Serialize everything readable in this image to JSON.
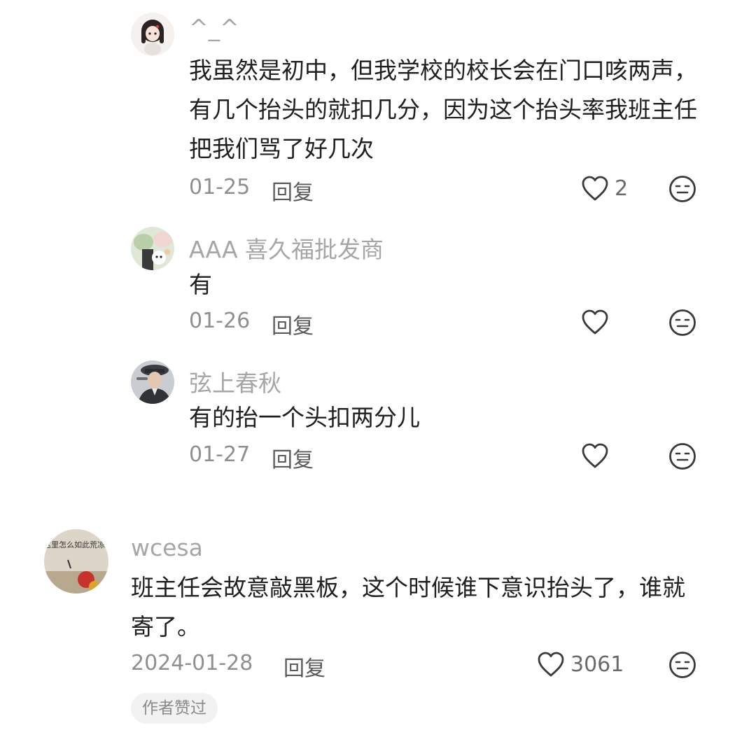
{
  "comments": [
    {
      "author": "^_^",
      "text": "我虽然是初中，但我学校的校长会在门口咳两声，有几个抬头的就扣几分，因为这个抬头率我班主任把我们骂了好几次",
      "date": "01-25",
      "reply_label": "回复",
      "likes": "2"
    },
    {
      "author": "AAA 喜久福批发商",
      "text": "有",
      "date": "01-26",
      "reply_label": "回复",
      "likes": ""
    },
    {
      "author": "弦上春秋",
      "text": "有的抬一个头扣两分儿",
      "date": "01-27",
      "reply_label": "回复",
      "likes": ""
    },
    {
      "author": "wcesa",
      "text": "班主任会故意敲黑板，这个时候谁下意识抬头了，谁就寄了。",
      "date": "2024-01-28",
      "reply_label": "回复",
      "likes": "3061",
      "badge": "作者赞过",
      "avatar_text": "这里怎么如此荒凉?"
    }
  ],
  "icons": {
    "like": "heart-outline-icon",
    "reaction": "neutral-face-icon"
  },
  "colors": {
    "author": "#a6a6a6",
    "text": "#1f1f1f",
    "meta": "#8f8f8f",
    "icon": "#3a3a3a",
    "chip_bg": "#f2f2f2"
  }
}
